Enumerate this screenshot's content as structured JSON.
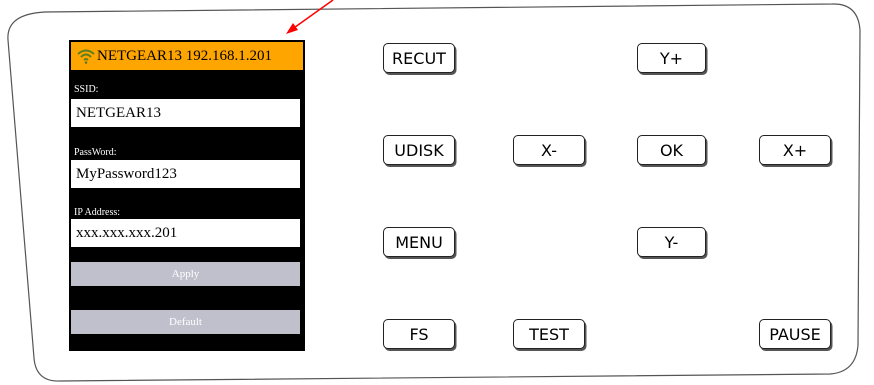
{
  "lcd": {
    "network_name": "NETGEAR13",
    "ip_display": "192.168.1.201",
    "ssid_label": "SSID:",
    "ssid_value": "NETGEAR13",
    "password_label": "PassWord:",
    "password_value": "MyPassword123",
    "ip_label": "IP Address:",
    "ip_value": "xxx.xxx.xxx.201",
    "apply_label": "Apply",
    "default_label": "Default",
    "header_color": "#ffa500",
    "wifi_icon": "wifi-icon"
  },
  "keys": {
    "recut": "RECUT",
    "udisk": "UDISK",
    "menu": "MENU",
    "fs": "FS",
    "test": "TEST",
    "x_minus": "X-",
    "x_plus": "X+",
    "y_plus": "Y+",
    "y_minus": "Y-",
    "ok": "OK",
    "pause": "PAUSE"
  },
  "annotation": {
    "arrow_color": "#ff0000"
  }
}
